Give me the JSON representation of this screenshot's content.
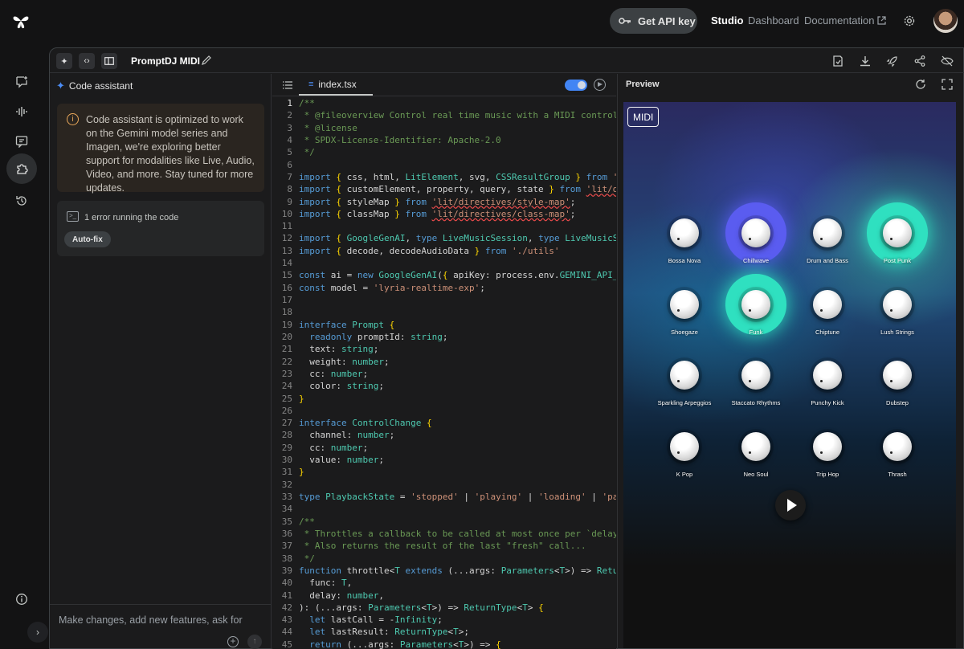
{
  "header": {
    "api_key_label": "Get API key",
    "nav": {
      "studio": "Studio",
      "dashboard": "Dashboard",
      "documentation": "Documentation"
    }
  },
  "toolbar": {
    "project_title": "PromptDJ MIDI"
  },
  "assistant": {
    "title": "Code assistant",
    "notice": "Code assistant is optimized to work on the Gemini model series and Imagen, we're exploring better support for modalities like Live, Audio, Video, and more. Stay tuned for more updates.",
    "error_text": "1 error running the code",
    "autofix_label": "Auto-fix",
    "input_placeholder": "Make changes, add new features, ask for"
  },
  "editor": {
    "tab_name": "index.tsx",
    "lines": [
      {
        "n": "1",
        "t": "/**"
      },
      {
        "n": "2",
        "t": " * @fileoverview Control real time music with a MIDI controller"
      },
      {
        "n": "3",
        "t": " * @license"
      },
      {
        "n": "4",
        "t": " * SPDX-License-Identifier: Apache-2.0"
      },
      {
        "n": "5",
        "t": " */"
      },
      {
        "n": "6",
        "t": ""
      },
      {
        "n": "7",
        "t": "import { css, html, LitElement, svg, CSSResultGroup } from 'lit'"
      },
      {
        "n": "8",
        "t": "import { customElement, property, query, state } from 'lit/decor"
      },
      {
        "n": "9",
        "t": "import { styleMap } from 'lit/directives/style-map';"
      },
      {
        "n": "10",
        "t": "import { classMap } from 'lit/directives/class-map';"
      },
      {
        "n": "11",
        "t": ""
      },
      {
        "n": "12",
        "t": "import { GoogleGenAI, type LiveMusicSession, type LiveMusicServe"
      },
      {
        "n": "13",
        "t": "import { decode, decodeAudioData } from './utils'"
      },
      {
        "n": "14",
        "t": ""
      },
      {
        "n": "15",
        "t": "const ai = new GoogleGenAI({ apiKey: process.env.GEMINI_API_KEY,"
      },
      {
        "n": "16",
        "t": "const model = 'lyria-realtime-exp';"
      },
      {
        "n": "17",
        "t": ""
      },
      {
        "n": "18",
        "t": ""
      },
      {
        "n": "19",
        "t": "interface Prompt {"
      },
      {
        "n": "20",
        "t": "  readonly promptId: string;"
      },
      {
        "n": "21",
        "t": "  text: string;"
      },
      {
        "n": "22",
        "t": "  weight: number;"
      },
      {
        "n": "23",
        "t": "  cc: number;"
      },
      {
        "n": "24",
        "t": "  color: string;"
      },
      {
        "n": "25",
        "t": "}"
      },
      {
        "n": "26",
        "t": ""
      },
      {
        "n": "27",
        "t": "interface ControlChange {"
      },
      {
        "n": "28",
        "t": "  channel: number;"
      },
      {
        "n": "29",
        "t": "  cc: number;"
      },
      {
        "n": "30",
        "t": "  value: number;"
      },
      {
        "n": "31",
        "t": "}"
      },
      {
        "n": "32",
        "t": ""
      },
      {
        "n": "33",
        "t": "type PlaybackState = 'stopped' | 'playing' | 'loading' | 'paused"
      },
      {
        "n": "34",
        "t": ""
      },
      {
        "n": "35",
        "t": "/**"
      },
      {
        "n": "36",
        "t": " * Throttles a callback to be called at most once per `delay` mi"
      },
      {
        "n": "37",
        "t": " * Also returns the result of the last \"fresh\" call..."
      },
      {
        "n": "38",
        "t": " */"
      },
      {
        "n": "39",
        "t": "function throttle<T extends (...args: Parameters<T>) => ReturnTy"
      },
      {
        "n": "40",
        "t": "  func: T,"
      },
      {
        "n": "41",
        "t": "  delay: number,"
      },
      {
        "n": "42",
        "t": "): (...args: Parameters<T>) => ReturnType<T> {"
      },
      {
        "n": "43",
        "t": "  let lastCall = -Infinity;"
      },
      {
        "n": "44",
        "t": "  let lastResult: ReturnType<T>;"
      },
      {
        "n": "45",
        "t": "  return (...args: Parameters<T>) => {"
      }
    ]
  },
  "preview": {
    "title": "Preview",
    "midi_label": "MIDI",
    "knobs": [
      {
        "label": "Bossa Nova",
        "color": "",
        "weight": 0
      },
      {
        "label": "Chillwave",
        "color": "#5a5cf0",
        "weight": 0.8
      },
      {
        "label": "Drum and Bass",
        "color": "",
        "weight": 0
      },
      {
        "label": "Post Punk",
        "color": "#2fe0c0",
        "weight": 0.8
      },
      {
        "label": "Shoegaze",
        "color": "",
        "weight": 0
      },
      {
        "label": "Funk",
        "color": "#2fe0c0",
        "weight": 0.8
      },
      {
        "label": "Chiptune",
        "color": "",
        "weight": 0
      },
      {
        "label": "Lush Strings",
        "color": "",
        "weight": 0
      },
      {
        "label": "Sparkling Arpeggios",
        "color": "",
        "weight": 0
      },
      {
        "label": "Staccato Rhythms",
        "color": "",
        "weight": 0
      },
      {
        "label": "Punchy Kick",
        "color": "",
        "weight": 0
      },
      {
        "label": "Dubstep",
        "color": "",
        "weight": 0
      },
      {
        "label": "K Pop",
        "color": "",
        "weight": 0
      },
      {
        "label": "Neo Soul",
        "color": "",
        "weight": 0
      },
      {
        "label": "Trip Hop",
        "color": "",
        "weight": 0
      },
      {
        "label": "Thrash",
        "color": "",
        "weight": 0
      }
    ]
  }
}
